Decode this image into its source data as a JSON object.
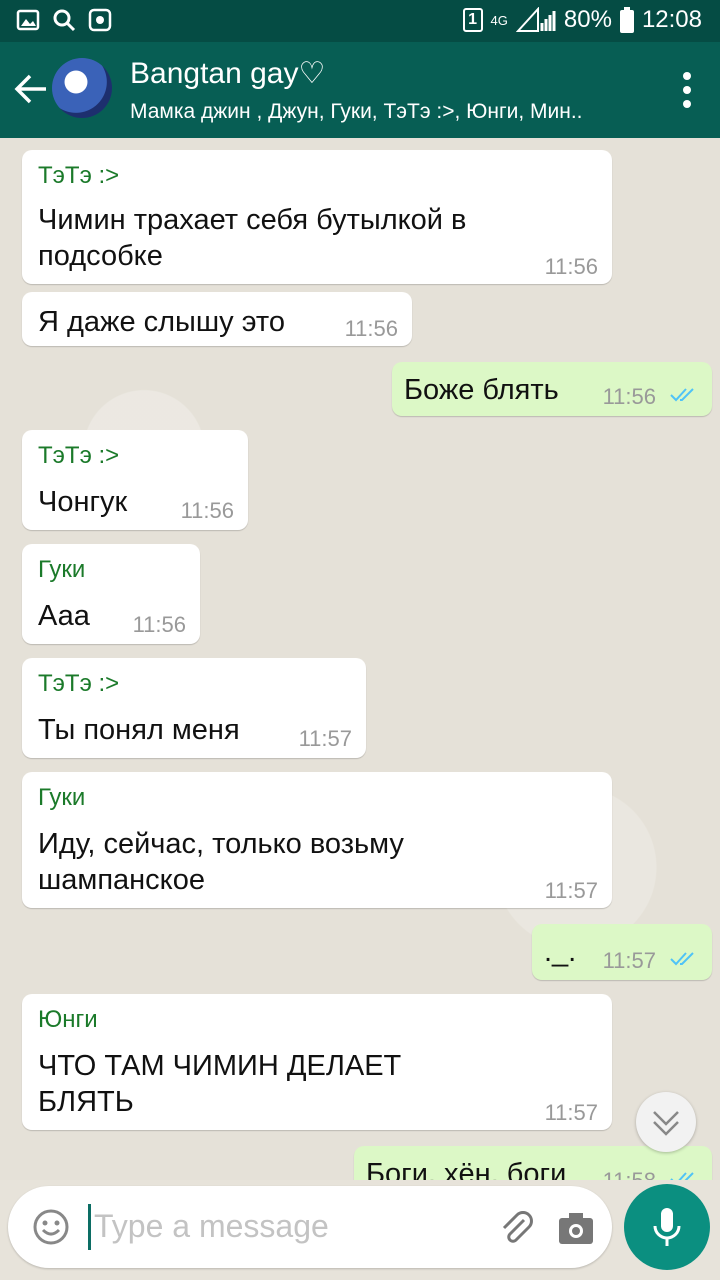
{
  "status_bar": {
    "sim_label": "1",
    "network": "4G",
    "battery": "80%",
    "time": "12:08"
  },
  "header": {
    "title": "Bangtan gay♡",
    "subtitle": "Мамка джин , Джун, Гуки, ТэТэ :>, Юнги, Мин.."
  },
  "messages": [
    {
      "sender": "ТэТэ :>",
      "text": "Чимин трахает себя бутылкой в подсобке",
      "time": "11:56"
    },
    {
      "text": "Я даже слышу это",
      "time": "11:56"
    },
    {
      "text": "Боже блять",
      "time": "11:56",
      "outgoing": true
    },
    {
      "sender": "ТэТэ :>",
      "text": "Чонгук",
      "time": "11:56"
    },
    {
      "sender": "Гуки",
      "text": "Ааа",
      "time": "11:56"
    },
    {
      "sender": "ТэТэ :>",
      "text": "Ты понял меня",
      "time": "11:57"
    },
    {
      "sender": "Гуки",
      "text": "Иду, сейчас, только возьму шампанское",
      "time": "11:57"
    },
    {
      "text": "._.",
      "time": "11:57",
      "outgoing": true
    },
    {
      "sender": "Юнги",
      "text": "ЧТО ТАМ ЧИМИН ДЕЛАЕТ БЛЯТЬ",
      "time": "11:57"
    },
    {
      "text": "Боги, хён, боги",
      "time": "11:58",
      "outgoing": true
    }
  ],
  "composer": {
    "placeholder": "Type a message"
  },
  "colors": {
    "header": "#075e54",
    "status_bar": "#054c44",
    "outgoing_bubble": "#dcf8c6",
    "sender_name": "#1b7a2a",
    "read_ticks": "#4fc3f7"
  },
  "icons": [
    "gallery-icon",
    "search-icon",
    "record-icon",
    "back-arrow-icon",
    "menu-dots-icon",
    "emoji-icon",
    "attach-icon",
    "camera-icon",
    "mic-icon",
    "scroll-down-icon",
    "double-check-icon"
  ]
}
